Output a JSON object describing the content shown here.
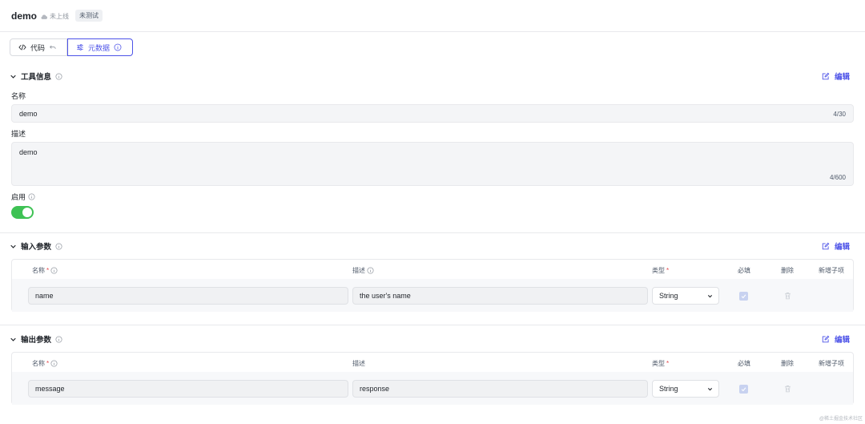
{
  "header": {
    "title": "demo",
    "status": "未上线",
    "badge": "未测试"
  },
  "tabs": [
    {
      "label": "代码"
    },
    {
      "label": "元数据"
    }
  ],
  "tool_info": {
    "title": "工具信息",
    "edit_label": "编辑",
    "name_label": "名称",
    "name_value": "demo",
    "name_count": "4/30",
    "desc_label": "描述",
    "desc_value": "demo",
    "desc_count": "4/600",
    "enable_label": "启用",
    "enabled": true
  },
  "input_params": {
    "title": "输入参数",
    "edit_label": "编辑",
    "columns": {
      "name": "名称",
      "desc": "描述",
      "type": "类型",
      "required": "必填",
      "delete": "删除",
      "add_child": "新增子项"
    },
    "rows": [
      {
        "name": "name",
        "desc": "the user's name",
        "type": "String",
        "required": true
      }
    ]
  },
  "output_params": {
    "title": "输出参数",
    "edit_label": "编辑",
    "columns": {
      "name": "名称",
      "desc": "描述",
      "type": "类型",
      "required": "必填",
      "delete": "删除",
      "add_child": "新增子项"
    },
    "rows": [
      {
        "name": "message",
        "desc": "response",
        "type": "String",
        "required": true
      }
    ]
  },
  "watermark": "@稀土掘金技术社区",
  "colors": {
    "accent": "#4d53e8",
    "toggle_on": "#3ec254",
    "required": "#e5484d"
  }
}
